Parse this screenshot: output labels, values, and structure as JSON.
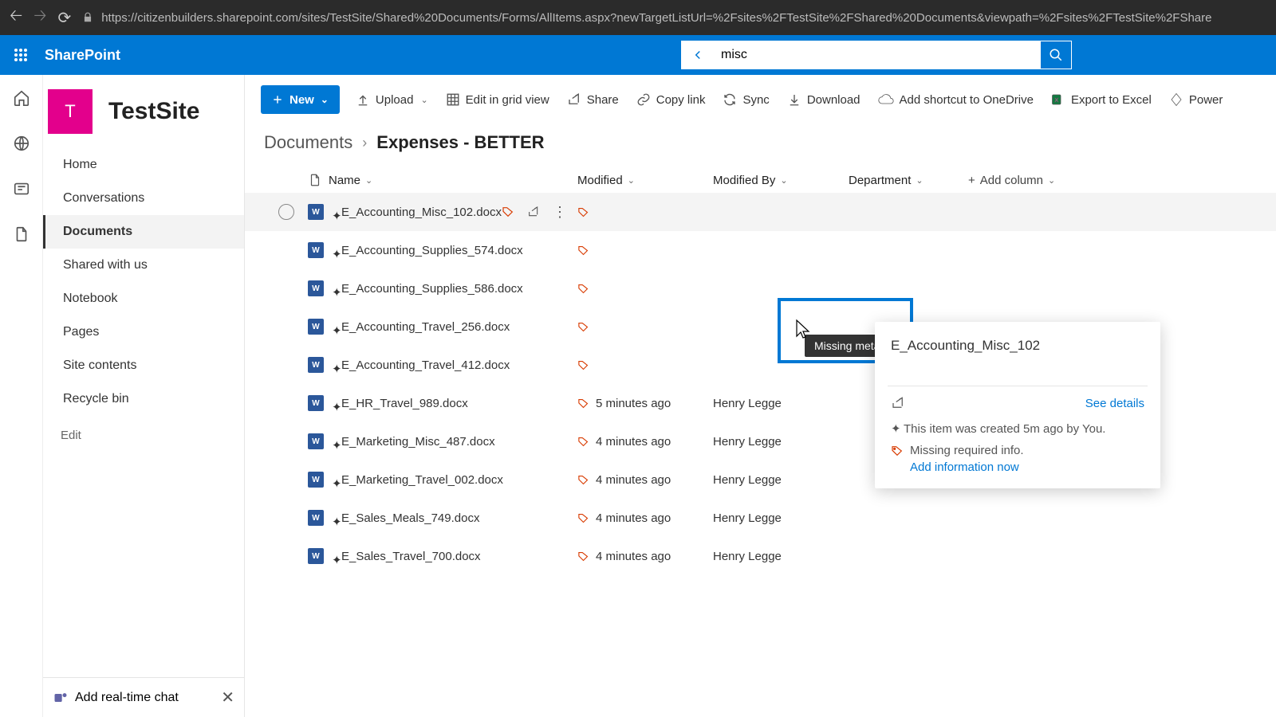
{
  "browser": {
    "url": "https://citizenbuilders.sharepoint.com/sites/TestSite/Shared%20Documents/Forms/AllItems.aspx?newTargetListUrl=%2Fsites%2FTestSite%2FShared%20Documents&viewpath=%2Fsites%2FTestSite%2FShare"
  },
  "brand": "SharePoint",
  "search": {
    "value": "misc"
  },
  "site": {
    "initial": "T",
    "title": "TestSite"
  },
  "nav": {
    "items": [
      "Home",
      "Conversations",
      "Documents",
      "Shared with us",
      "Notebook",
      "Pages",
      "Site contents",
      "Recycle bin"
    ],
    "active_index": 2,
    "edit": "Edit"
  },
  "chat_prompt": "Add real-time chat",
  "commands": {
    "new": "New",
    "upload": "Upload",
    "grid": "Edit in grid view",
    "share": "Share",
    "copy": "Copy link",
    "sync": "Sync",
    "download": "Download",
    "shortcut": "Add shortcut to OneDrive",
    "export": "Export to Excel",
    "power": "Power"
  },
  "breadcrumb": {
    "root": "Documents",
    "leaf": "Expenses - BETTER"
  },
  "columns": {
    "name": "Name",
    "modified": "Modified",
    "modified_by": "Modified By",
    "department": "Department",
    "add": "Add column"
  },
  "rows": [
    {
      "name": "E_Accounting_Misc_102.docx",
      "modified": "",
      "modified_by": "",
      "selected": true
    },
    {
      "name": "E_Accounting_Supplies_574.docx",
      "modified": "",
      "modified_by": ""
    },
    {
      "name": "E_Accounting_Supplies_586.docx",
      "modified": "",
      "modified_by": ""
    },
    {
      "name": "E_Accounting_Travel_256.docx",
      "modified": "",
      "modified_by": ""
    },
    {
      "name": "E_Accounting_Travel_412.docx",
      "modified": "",
      "modified_by": ""
    },
    {
      "name": "E_HR_Travel_989.docx",
      "modified": "5 minutes ago",
      "modified_by": "Henry Legge"
    },
    {
      "name": "E_Marketing_Misc_487.docx",
      "modified": "4 minutes ago",
      "modified_by": "Henry Legge"
    },
    {
      "name": "E_Marketing_Travel_002.docx",
      "modified": "4 minutes ago",
      "modified_by": "Henry Legge"
    },
    {
      "name": "E_Sales_Meals_749.docx",
      "modified": "4 minutes ago",
      "modified_by": "Henry Legge"
    },
    {
      "name": "E_Sales_Travel_700.docx",
      "modified": "4 minutes ago",
      "modified_by": "Henry Legge"
    }
  ],
  "tooltip": "Missing metadata",
  "card": {
    "title": "E_Accounting_Misc_102",
    "details": "See details",
    "created": "This item was created 5m ago by You.",
    "missing": "Missing required info.",
    "add_now": "Add information now"
  }
}
